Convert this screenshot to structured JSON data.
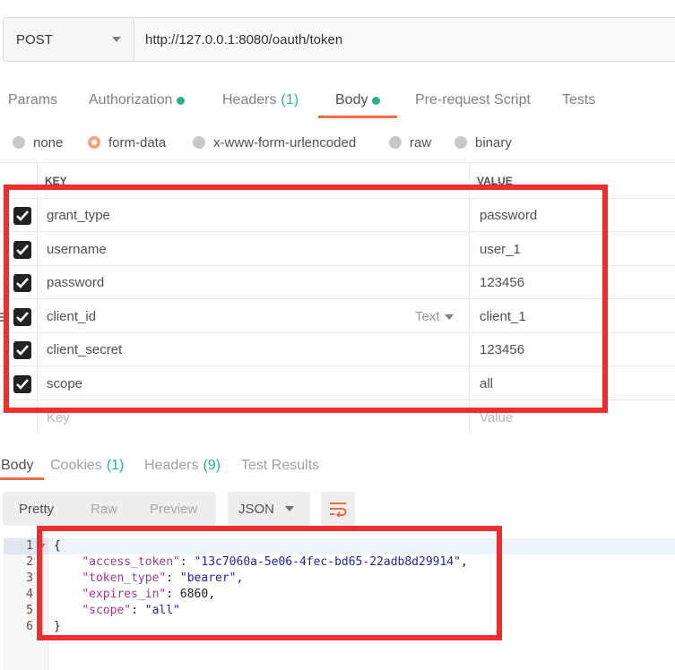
{
  "request": {
    "method": "POST",
    "url": "http://127.0.0.1:8080/oauth/token"
  },
  "request_tabs": [
    {
      "label": "Params"
    },
    {
      "label": "Authorization",
      "dot": true
    },
    {
      "label": "Headers",
      "count": "(1)"
    },
    {
      "label": "Body",
      "dot": true,
      "active": true
    },
    {
      "label": "Pre-request Script"
    },
    {
      "label": "Tests"
    }
  ],
  "body_types": [
    {
      "label": "none",
      "checked": false
    },
    {
      "label": "form-data",
      "checked": true
    },
    {
      "label": "x-www-form-urlencoded",
      "checked": false
    },
    {
      "label": "raw",
      "checked": false
    },
    {
      "label": "binary",
      "checked": false
    }
  ],
  "form_table": {
    "key_header": "KEY",
    "value_header": "VALUE",
    "rows": [
      {
        "key": "grant_type",
        "value": "password"
      },
      {
        "key": "username",
        "value": "user_1"
      },
      {
        "key": "password",
        "value": "123456"
      },
      {
        "key": "client_id",
        "value": "client_1",
        "type_label": "Text"
      },
      {
        "key": "client_secret",
        "value": "123456"
      },
      {
        "key": "scope",
        "value": "all"
      }
    ],
    "key_placeholder": "Key",
    "value_placeholder": "Value"
  },
  "response_tabs": [
    {
      "label": "Body",
      "active": true
    },
    {
      "label": "Cookies",
      "count": "(1)"
    },
    {
      "label": "Headers",
      "count": "(9)"
    },
    {
      "label": "Test Results"
    }
  ],
  "response_view": {
    "modes": [
      "Pretty",
      "Raw",
      "Preview"
    ],
    "format": "JSON",
    "wrap_icon": "wrap-lines-icon"
  },
  "response_code": {
    "line_numbers": [
      "1",
      "2",
      "3",
      "4",
      "5",
      "6"
    ],
    "open_brace": "{",
    "close_brace": "}",
    "entries": [
      {
        "key": "\"access_token\"",
        "value": "\"13c7060a-5e06-4fec-bd65-22adb8d29914\"",
        "suffix": ","
      },
      {
        "key": "\"token_type\"",
        "value": "\"bearer\"",
        "suffix": ","
      },
      {
        "key": "\"expires_in\"",
        "value": "6860",
        "suffix": ","
      },
      {
        "key": "\"scope\"",
        "value": "\"all\"",
        "suffix": ""
      }
    ]
  },
  "colors": {
    "accent": "#f26b3a",
    "status_green": "#26b47f",
    "annotation_red": "#f02d2d"
  }
}
